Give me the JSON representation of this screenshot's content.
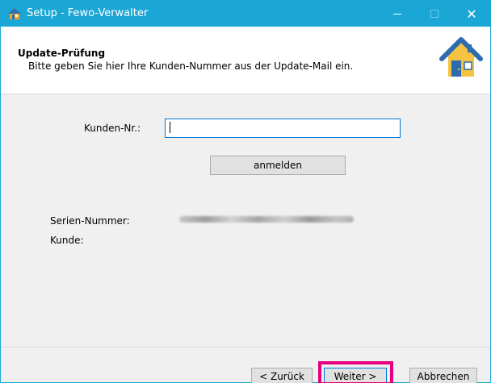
{
  "window": {
    "title": "Setup - Fewo-Verwalter",
    "minimize_icon": "minimize-icon",
    "maximize_icon": "maximize-icon",
    "close_glyph": "✕"
  },
  "header": {
    "title": "Update-Prüfung",
    "subtitle": "Bitte geben Sie hier Ihre Kunden-Nummer aus der Update-Mail ein.",
    "logo_icon": "house-icon"
  },
  "form": {
    "kunden_label": "Kunden-Nr.:",
    "kunden_value": "",
    "anmelden_label": "anmelden",
    "serien_label": "Serien-Nummer:",
    "kunde_label": "Kunde:"
  },
  "footer": {
    "back_label": "< Zurück",
    "next_label": "Weiter >",
    "cancel_label": "Abbrechen"
  },
  "colors": {
    "titlebar": "#1ba7d6",
    "highlight": "#e6007e",
    "focus": "#0078d7"
  }
}
